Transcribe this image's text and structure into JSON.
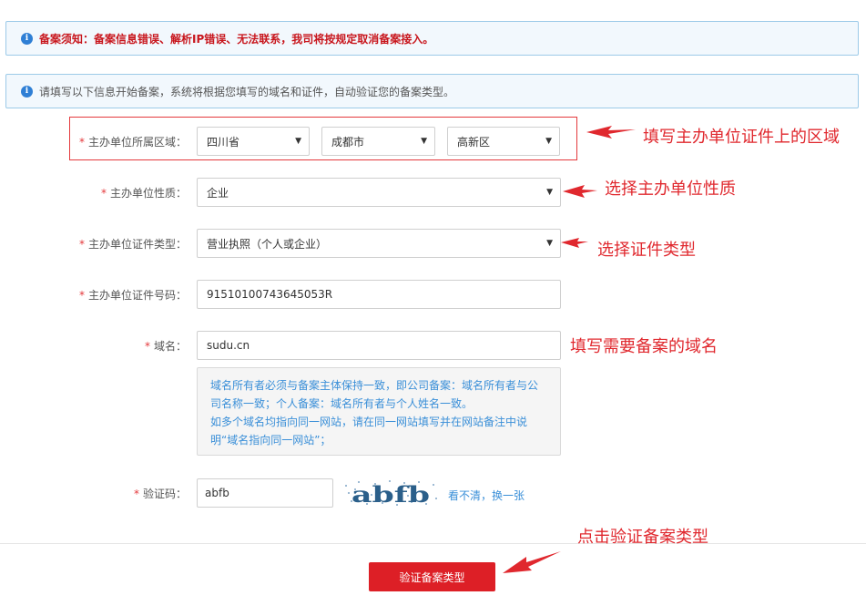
{
  "notices": {
    "warning": "备案须知：备案信息错误、解析IP错误、无法联系，我司将按规定取消备案接入。",
    "info": "请填写以下信息开始备案，系统将根据您填写的域名和证件，自动验证您的备案类型。",
    "icon_glyph": "i"
  },
  "form": {
    "required_mark": "*",
    "region": {
      "label": "主办单位所属区域：",
      "province": "四川省",
      "city": "成都市",
      "district": "高新区"
    },
    "nature": {
      "label": "主办单位性质：",
      "value": "企业"
    },
    "cert_type": {
      "label": "主办单位证件类型：",
      "value": "营业执照（个人或企业）"
    },
    "cert_number": {
      "label": "主办单位证件号码：",
      "value": "91510100743645053R"
    },
    "domain": {
      "label": "域名：",
      "value": "sudu.cn",
      "hint_lines": [
        "域名所有者必须与备案主体保持一致，即公司备案：域名所有者与公",
        "司名称一致；个人备案：域名所有者与个人姓名一致。",
        "如多个域名均指向同一网站，请在同一网站填写并在网站备注中说",
        "明“域名指向同一网站”；"
      ]
    },
    "captcha": {
      "label": "验证码：",
      "value": "abfb",
      "image_text": "abfb",
      "refresh": "看不清，换一张"
    },
    "select_caret": "▼"
  },
  "submit": {
    "label": "验证备案类型"
  },
  "annotations": {
    "region": "填写主办单位证件上的区域",
    "nature": "选择主办单位性质",
    "cert_type": "选择证件类型",
    "domain": "填写需要备案的域名",
    "submit": "点击验证备案类型"
  },
  "colors": {
    "accent_red": "#dd1f26",
    "annotation_red": "#e0282e",
    "link_blue": "#3a8fd8",
    "notice_bg": "#f2f8fd"
  }
}
